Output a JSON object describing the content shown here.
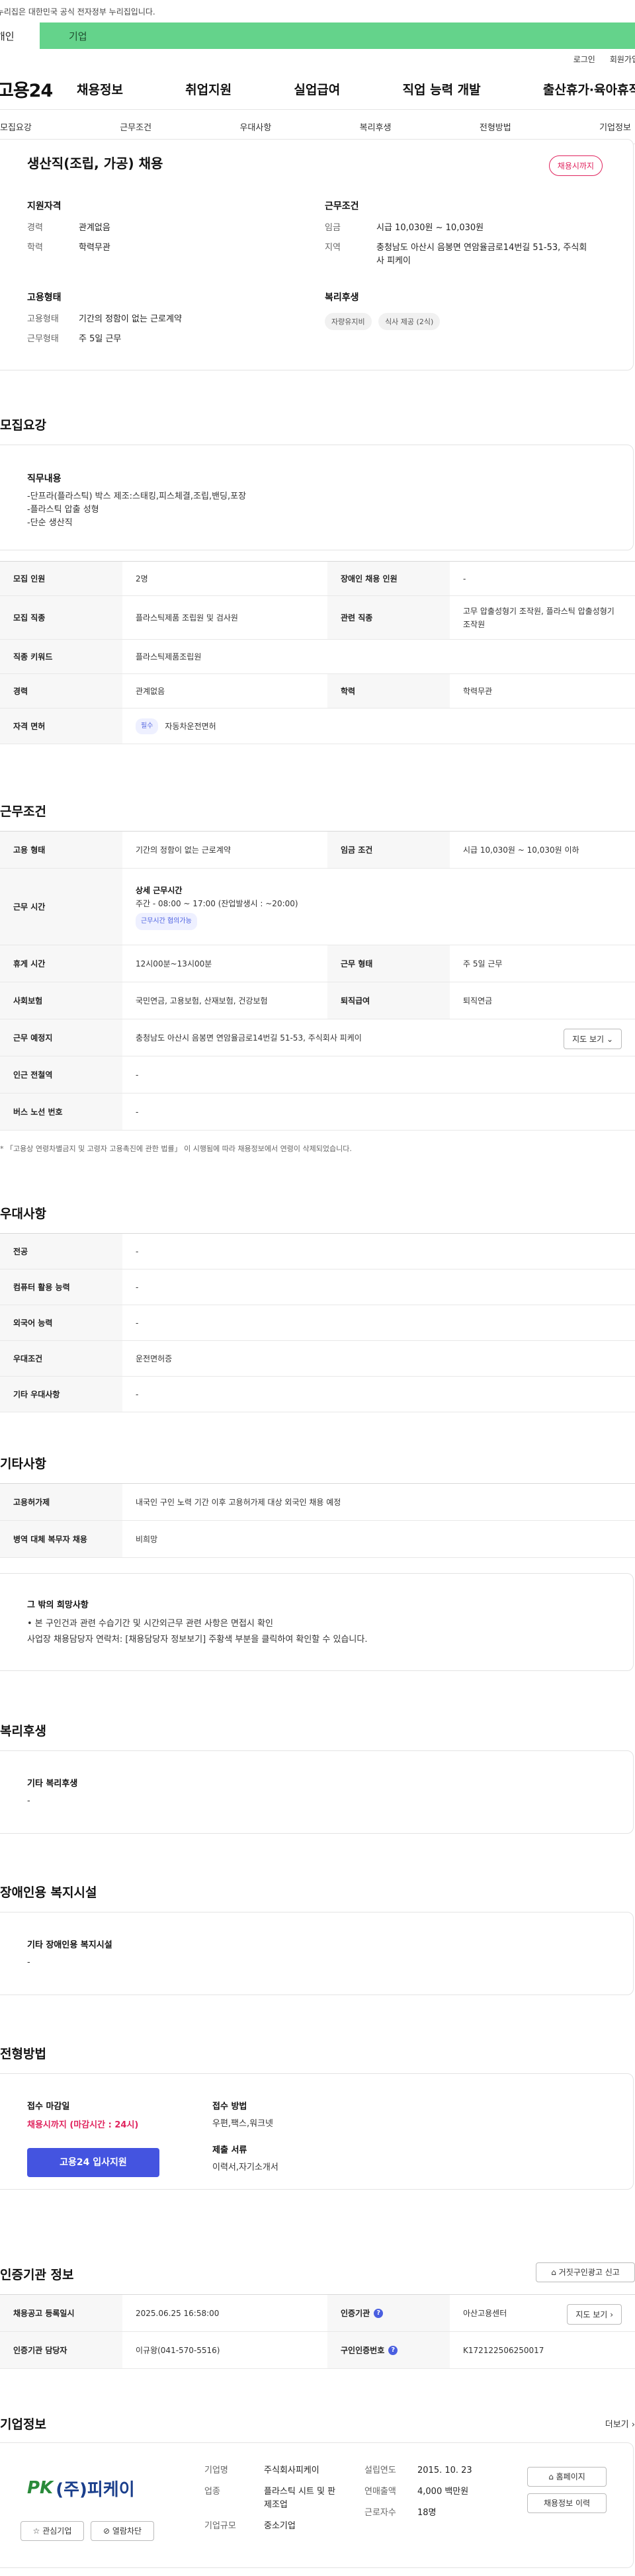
{
  "gov_banner": "이 누리집은 대한민국 공식 전자정부 누리집입니다.",
  "top_tabs": {
    "personal": "개인",
    "company": "기업"
  },
  "util": {
    "login": "로그인",
    "join": "회원가입"
  },
  "logo": "고용24",
  "gnb": [
    "채용정보",
    "취업지원",
    "실업급여",
    "직업 능력 개발",
    "출산휴가·육아휴직"
  ],
  "subnav": [
    "모집요강",
    "근무조건",
    "우대사항",
    "복리후생",
    "전형방법",
    "기업정보"
  ],
  "summary": {
    "title": "생산직(조립, 가공) 채용",
    "status": "채용시까지",
    "qualification": {
      "head": "지원자격",
      "rows": [
        {
          "k": "경력",
          "v": "관계없음"
        },
        {
          "k": "학력",
          "v": "학력무관"
        }
      ]
    },
    "work_cond": {
      "head": "근무조건",
      "rows": [
        {
          "k": "임금",
          "v": "시급 10,030원 ~ 10,030원"
        },
        {
          "k": "지역",
          "v": "충청남도 아산시 음봉면 연암율금로14번길 51-53, 주식회사 피케이"
        }
      ]
    },
    "employment": {
      "head": "고용형태",
      "rows": [
        {
          "k": "고용형태",
          "v": "기간의 정함이 없는 근로계약"
        },
        {
          "k": "근무형태",
          "v": "주 5일 근무"
        }
      ]
    },
    "welfare": {
      "head": "복리후생",
      "chips": [
        "자량유지비",
        "식사 제공 (2식)"
      ]
    }
  },
  "recruit": {
    "title": "모집요강",
    "duty_head": "직무내용",
    "duty_lines": [
      "-단프라(플라스틱) 박스 제조:스태킹,피스체결,조립,밴딩,포장",
      "-플라스틱 압출 성형",
      "-단순 생산직"
    ],
    "rows": [
      {
        "k1": "모집 인원",
        "v1": "2명",
        "k2": "장애인 채용 인원",
        "v2": "-"
      },
      {
        "k1": "모집 직종",
        "v1": "플라스틱제품 조립원 및 검사원",
        "k2": "관련 직종",
        "v2": "고무 압출성형기 조작원, 플라스틱 압출성형기 조작원"
      },
      {
        "k1": "직종 키워드",
        "v1": "플라스틱제품조립원"
      },
      {
        "k1": "경력",
        "v1": "관계없음",
        "k2": "학력",
        "v2": "학력무관"
      },
      {
        "k1": "자격 면허",
        "chip": "필수",
        "v1": "자동차운전면허"
      }
    ]
  },
  "work": {
    "title": "근무조건",
    "rows": {
      "type_k": "고용 형태",
      "type_v": "기간의 정함이 없는 근로계약",
      "wage_k": "임금 조건",
      "wage_v": "시급 10,030원 ~ 10,030원 이하",
      "hours_k": "근무 시간",
      "hours_head": "상세 근무시간",
      "hours_v": "주간 - 08:00 ~ 17:00 (잔업발생시 : ~20:00)",
      "hours_chip": "근무시간 협의가능",
      "rest_k": "휴게 시간",
      "rest_v": "12시00분~13시00분",
      "form_k": "근무 형태",
      "form_v": "주 5일 근무",
      "ins_k": "사회보험",
      "ins_v": "국민연금, 고용보험, 산재보험, 건강보험",
      "ret_k": "퇴직급여",
      "ret_v": "퇴직연금",
      "place_k": "근무 예정지",
      "place_v": "충청남도 아산시 음봉면 연암율금로14번길 51-53, 주식회사 피케이",
      "map": "지도 보기",
      "sub_k": "인근 전철역",
      "sub_v": "-",
      "bus_k": "버스 노선 번호",
      "bus_v": "-"
    },
    "note": "* 「고용상 연령차별금지 및 고령자 고용촉진에 관한 법률」 이 시행됨에 따라 채용정보에서 연령이 삭제되었습니다."
  },
  "pref": {
    "title": "우대사항",
    "rows": [
      {
        "k": "전공",
        "v": "-"
      },
      {
        "k": "컴퓨터 활용 능력",
        "v": "-"
      },
      {
        "k": "외국어 능력",
        "v": "-"
      },
      {
        "k": "우대조건",
        "v": "운전면허증"
      },
      {
        "k": "기타 우대사항",
        "v": "-"
      }
    ]
  },
  "etc": {
    "title": "기타사항",
    "rows": [
      {
        "k": "고용허가제",
        "v": "내국인 구인 노력 기간 이후 고용허가제 대상 외국인 채용 예정"
      },
      {
        "k": "병역 대체 복무자 채용",
        "v": "비희망"
      }
    ],
    "extra_head": "그 밖의 희망사항",
    "extra_lines": [
      "• 본 구인건과 관련 수습기간 및 시간외근무 관련 사항은 면접시 확인",
      "사업장 채용담당자 연락처: [채용담당자 정보보기] 주황색 부분을 클릭하여 확인할 수 있습니다."
    ]
  },
  "welfare": {
    "title": "복리후생",
    "head": "기타 복리후생",
    "value": "-"
  },
  "disabled": {
    "title": "장애인용 복지시설",
    "head": "기타 장애인용 복지시설",
    "value": "-"
  },
  "process": {
    "title": "전형방법",
    "deadline_head": "접수 마감일",
    "deadline_value": "채용시까지 (마감시간 : 24시)",
    "method_head": "접수 방법",
    "method_value": "우편,팩스,워크넷",
    "docs_head": "제출 서류",
    "docs_value": "이력서,자기소개서",
    "apply": "고용24 입사지원"
  },
  "cert": {
    "title": "인증기관 정보",
    "report_btn": "거짓구인광고 신고",
    "rows": {
      "reg_k": "채용공고 등록일시",
      "reg_v": "2025.06.25 16:58:00",
      "org_k": "인증기관",
      "org_v": "아산고용센터",
      "map": "지도 보기",
      "mgr_k": "인증기관 담당자",
      "mgr_v": "이규왕(041-570-5516)",
      "no_k": "구인인증번호",
      "no_v": "K172122506250017"
    }
  },
  "company": {
    "title": "기업정보",
    "more": "더보기",
    "logo_text": "(주)피케이",
    "logo_sub": "PK",
    "interest": "관심기업",
    "block": "열람차단",
    "fields": [
      {
        "k": "기업명",
        "v": "주식회사피케이"
      },
      {
        "k": "업종",
        "v": "플라스틱 시트 및 판 제조업"
      },
      {
        "k": "기업규모",
        "v": "중소기업"
      }
    ],
    "fields2": [
      {
        "k": "설립연도",
        "v": "2015. 10. 23"
      },
      {
        "k": "연매출액",
        "v": "4,000 백만원"
      },
      {
        "k": "근로자수",
        "v": "18명"
      }
    ],
    "homepage": "홈페이지",
    "history": "채용정보 이력"
  }
}
